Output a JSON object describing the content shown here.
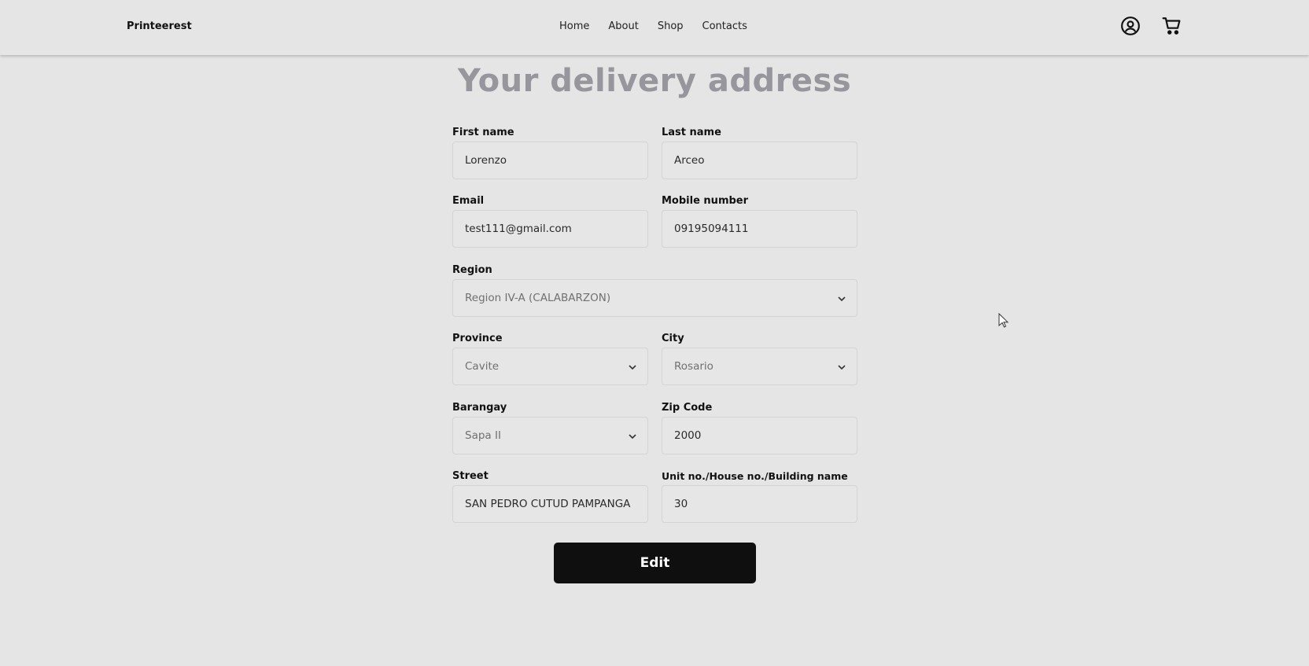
{
  "nav": {
    "brand": "Printeerest",
    "links": [
      "Home",
      "About",
      "Shop",
      "Contacts"
    ],
    "icons": {
      "user": "user-circle-icon",
      "cart": "cart-icon"
    }
  },
  "page": {
    "title": "Your delivery address"
  },
  "form": {
    "first_name": {
      "label": "First name",
      "value": "Lorenzo"
    },
    "last_name": {
      "label": "Last name",
      "value": "Arceo"
    },
    "email": {
      "label": "Email",
      "value": "test111@gmail.com"
    },
    "mobile": {
      "label": "Mobile number",
      "value": "09195094111"
    },
    "region": {
      "label": "Region",
      "value": "Region IV-A (CALABARZON)"
    },
    "province": {
      "label": "Province",
      "value": "Cavite"
    },
    "city": {
      "label": "City",
      "value": "Rosario"
    },
    "barangay": {
      "label": "Barangay",
      "value": "Sapa II"
    },
    "zip": {
      "label": "Zip Code",
      "value": "2000"
    },
    "street": {
      "label": "Street",
      "value": "SAN PEDRO CUTUD PAMPANGA"
    },
    "unit": {
      "label": "Unit no./House no./Building name",
      "value": "30"
    }
  },
  "actions": {
    "edit_label": "Edit"
  },
  "colors": {
    "background": "#e5e5e5",
    "title": "#96969c",
    "button": "#0f0f0f"
  }
}
